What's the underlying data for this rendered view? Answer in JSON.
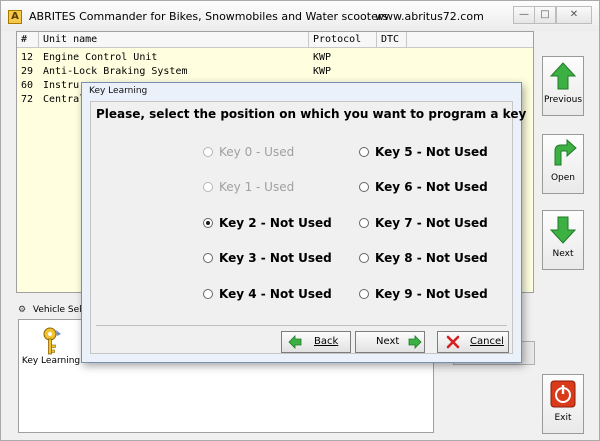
{
  "window": {
    "title": "ABRITES Commander for Bikes, Snowmobiles and Water scooters",
    "url": "www.abritus72.com",
    "app_icon_letter": "A"
  },
  "units_table": {
    "columns": [
      "#",
      "Unit name",
      "Protocol",
      "DTC"
    ],
    "rows": [
      {
        "num": "12",
        "name": "Engine Control Unit",
        "protocol": "KWP"
      },
      {
        "num": "29",
        "name": "Anti-Lock Braking System",
        "protocol": "KWP"
      },
      {
        "num": "60",
        "name": "Instru",
        "protocol": ""
      },
      {
        "num": "72",
        "name": "Central",
        "protocol": ""
      }
    ]
  },
  "side_buttons": {
    "previous": "Previous",
    "open": "Open",
    "next": "Next",
    "exit": "Exit"
  },
  "bottom": {
    "tab_label": "Vehicle Selec",
    "key_learning_label": "Key Learning"
  },
  "dialog": {
    "title": "Key Learning",
    "prompt": "Please, select the position on which you want to program a key",
    "left_options": [
      {
        "label": "Key 0 - Used",
        "enabled": false,
        "checked": false
      },
      {
        "label": "Key 1 - Used",
        "enabled": false,
        "checked": false
      },
      {
        "label": "Key 2 - Not Used",
        "enabled": true,
        "checked": true
      },
      {
        "label": "Key 3 - Not Used",
        "enabled": true,
        "checked": false
      },
      {
        "label": "Key 4 - Not Used",
        "enabled": true,
        "checked": false
      }
    ],
    "right_options": [
      {
        "label": "Key 5 - Not Used",
        "enabled": true,
        "checked": false
      },
      {
        "label": "Key 6 - Not Used",
        "enabled": true,
        "checked": false
      },
      {
        "label": "Key 7 - Not Used",
        "enabled": true,
        "checked": false
      },
      {
        "label": "Key 8 - Not Used",
        "enabled": true,
        "checked": false
      },
      {
        "label": "Key 9 - Not Used",
        "enabled": true,
        "checked": false
      }
    ],
    "buttons": {
      "back": "Back",
      "next": "Next",
      "cancel": "Cancel"
    }
  },
  "colors": {
    "list_background": "#ffffe0",
    "arrow_green": "#3cb043",
    "exit_red": "#d83a1a",
    "cancel_red": "#d62020"
  }
}
